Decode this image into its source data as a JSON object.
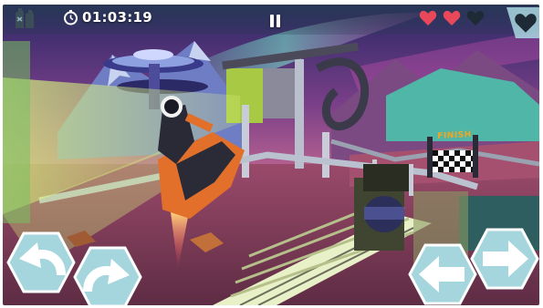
{
  "hud": {
    "timer": "01:03:19",
    "finish_sign": "FINISH",
    "lives": {
      "total": 3,
      "remaining": 2
    },
    "icons": {
      "fuel": "jerrycan-icon",
      "clock": "stopwatch-icon",
      "pause": "pause-icon",
      "heart": "heart-icon",
      "bonus": "heart-icon"
    }
  },
  "controls": {
    "lean_back": "rotate-ccw-arrow-icon",
    "lean_forward": "rotate-cw-arrow-icon",
    "brake": "left-arrow-icon",
    "accelerate": "right-arrow-icon"
  },
  "colors": {
    "hud_bar": "#2d4458",
    "heart_full": "#e8485a",
    "heart_empty": "#1e2b36",
    "button_fill": "#a5d6de",
    "button_border": "#ffffff",
    "button_arrow": "#ffffff",
    "finish_text": "#f6a51e",
    "ground": "#7a3a55",
    "sky": "#2c2a66"
  }
}
